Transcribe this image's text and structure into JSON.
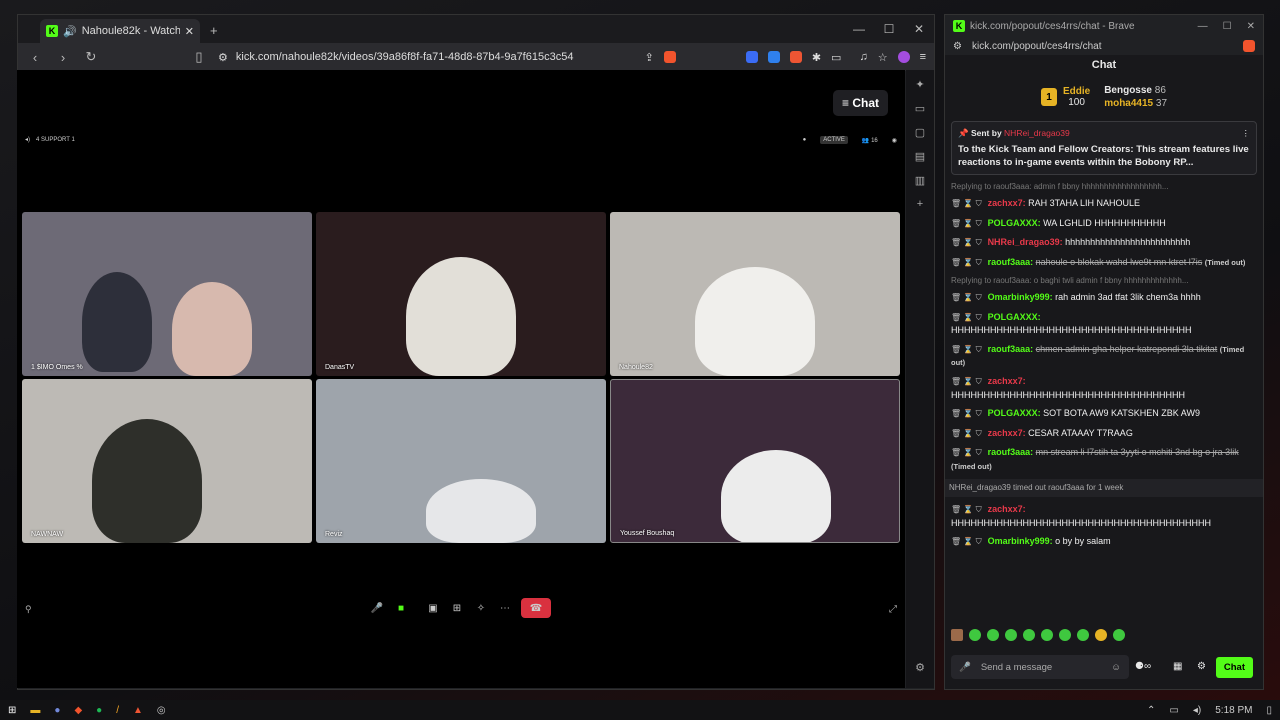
{
  "browser": {
    "tab_title": "Nahoule82k - Watch the VOD",
    "url": "kick.com/nahoule82k/videos/39a86f8f-fa71-48d8-87b4-9a7f615c3c54",
    "shield_count": "2"
  },
  "video": {
    "chat_button": "Chat",
    "top_left": "4 SUPPORT 1",
    "active_label": "ACTIVE",
    "viewer_count": "16",
    "tiles": [
      {
        "name": "1 $IMO Omes %",
        "bg": "#6d6a76"
      },
      {
        "name": "DanasTV",
        "bg": "#2a1c1e"
      },
      {
        "name": "Nahoule82",
        "bg": "#bcb9b4"
      },
      {
        "name": "NAWNAW",
        "bg": "#bdbab5"
      },
      {
        "name": "Reviz",
        "bg": "#9ea4ab"
      },
      {
        "name": "Youssef Boushaq",
        "bg": "#3c2a3a"
      }
    ]
  },
  "chat_window": {
    "title": "kick.com/popout/ces4rrs/chat - Brave",
    "url": "kick.com/popout/ces4rrs/chat",
    "header": "Chat",
    "leaderboard": {
      "first_name": "Eddie",
      "first_value": "100",
      "second_name": "Bengosse",
      "second_value": "86",
      "third_name": "moha4415",
      "third_value": "37"
    },
    "pinned": {
      "sent_by": "Sent by",
      "user": "NHRei_dragao39",
      "text": "To the Kick Team and Fellow Creators: This stream features live reactions to in-game events within the Bobony RP..."
    },
    "messages": [
      {
        "reply": "Replying to raouf3aaa: admin f bbny hhhhhhhhhhhhhhhhhh...",
        "user": "zachxx7:",
        "color": "#e8394a",
        "text": "RAH 3TAHA LIH NAHOULE"
      },
      {
        "user": "POLGAXXX:",
        "color": "#53fc18",
        "text": "WA LGHLID HHHHHHHHHHH"
      },
      {
        "user": "NHRei_dragao39:",
        "color": "#e8394a",
        "text": "hhhhhhhhhhhhhhhhhhhhhhhhh"
      },
      {
        "user": "raouf3aaa:",
        "color": "#53fc18",
        "text": "nahoule o blokak wahd lwe9t mn ktret l7is",
        "timed": "(Timed out)",
        "strike": true
      },
      {
        "reply": "Replying to raouf3aaa: o baghi twli admin f bbny hhhhhhhhhhhhh...",
        "user": "Omarbinky999:",
        "color": "#53fc18",
        "text": "rah admin 3ad tfat 3lik chem3a hhhh"
      },
      {
        "user": "POLGAXXX:",
        "color": "#53fc18",
        "text": "HHHHHHHHHHHHHHHHHHHHHHHHHHHHHHHHHHHHH"
      },
      {
        "user": "raouf3aaa:",
        "color": "#53fc18",
        "text": "chmen admin gha helper katrepondi 3la tikitat",
        "timed": "(Timed out)",
        "strike": true
      },
      {
        "user": "zachxx7:",
        "color": "#e8394a",
        "text": "HHHHHHHHHHHHHHHHHHHHHHHHHHHHHHHHHHHH"
      },
      {
        "user": "POLGAXXX:",
        "color": "#53fc18",
        "text": "SOT BOTA AW9 KATSKHEN ZBK AW9"
      },
      {
        "user": "zachxx7:",
        "color": "#e8394a",
        "text": "CESAR ATAAAY T7RAAG"
      },
      {
        "user": "raouf3aaa:",
        "color": "#53fc18",
        "text": "mn stream li l7stih ta 3yyti o mchiti 3nd bg o jra 3lik",
        "timed": "(Timed out)",
        "strike": true
      }
    ],
    "system_message": "NHRei_dragao39 timed out raouf3aaa for 1 week",
    "messages_after": [
      {
        "user": "zachxx7:",
        "color": "#e8394a",
        "text": "HHHHHHHHHHHHHHHHHHHHHHHHHHHHHHHHHHHHHHHH"
      },
      {
        "user": "Omarbinky999:",
        "color": "#53fc18",
        "text": "o by by salam"
      }
    ],
    "input_placeholder": "Send a message",
    "send_label": "Chat"
  },
  "taskbar": {
    "time": "5:18 PM"
  }
}
